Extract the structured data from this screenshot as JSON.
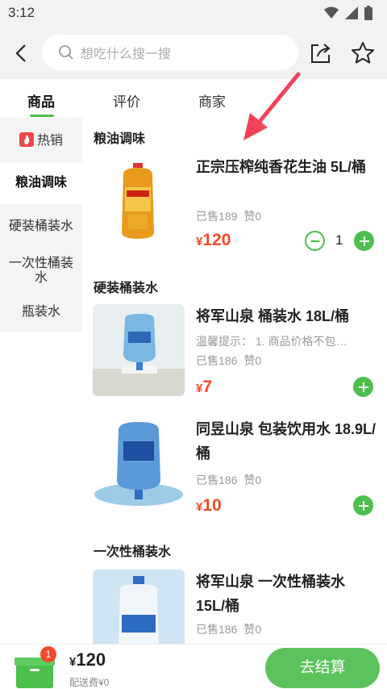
{
  "status": {
    "time": "3:12"
  },
  "search": {
    "placeholder": "想吃什么搜一搜"
  },
  "tabs": [
    {
      "label": "商品",
      "active": true
    },
    {
      "label": "评价",
      "active": false
    },
    {
      "label": "商家",
      "active": false
    }
  ],
  "sidebar": {
    "items": [
      {
        "label": "热销"
      },
      {
        "label": "粮油调味"
      },
      {
        "label": "硬装桶装水"
      },
      {
        "label": "一次性桶装水"
      },
      {
        "label": "瓶装水"
      }
    ]
  },
  "sections": [
    {
      "title": "粮油调味",
      "products": [
        {
          "name": "正宗压榨纯香花生油 5L/桶",
          "sold": "已售189",
          "likes": "赞0",
          "price_symbol": "¥",
          "price": "120",
          "qty": "1"
        }
      ]
    },
    {
      "title": "硬装桶装水",
      "products": [
        {
          "name": "将军山泉 桶装水 18L/桶",
          "tip": "温馨提示：   1. 商品价格不包…",
          "sold": "已售186",
          "likes": "赞0",
          "price_symbol": "¥",
          "price": "7"
        },
        {
          "name": "同昱山泉 包装饮用水 18.9L/桶",
          "sold": "已售186",
          "likes": "赞0",
          "price_symbol": "¥",
          "price": "10"
        }
      ]
    },
    {
      "title": "一次性桶装水",
      "products": [
        {
          "name": "将军山泉 一次性桶装水 15L/桶",
          "sold": "已售186",
          "likes": "赞0"
        }
      ]
    }
  ],
  "cart": {
    "badge": "1",
    "total_symbol": "¥",
    "total": "120",
    "delivery": "配送费¥0",
    "checkout_label": "去结算"
  },
  "colors": {
    "accent": "#4cbf4c",
    "price": "#f04a2a",
    "checkout": "#5cc25c"
  }
}
